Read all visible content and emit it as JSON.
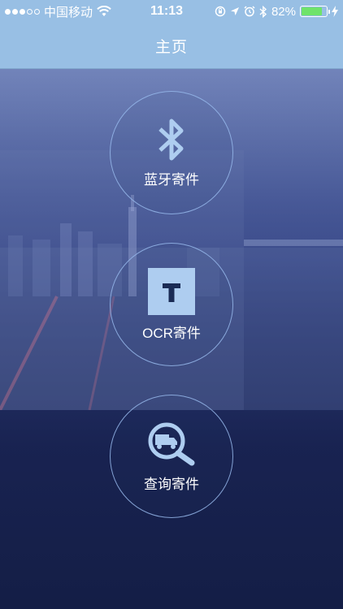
{
  "status_bar": {
    "carrier": "中国移动",
    "time": "11:13",
    "battery_percent": "82%",
    "battery_level": 0.82,
    "signal_bars_filled": 3,
    "signal_bars_total": 5
  },
  "nav": {
    "title": "主页"
  },
  "actions": [
    {
      "label": "蓝牙寄件",
      "icon": "bluetooth-icon"
    },
    {
      "label": "OCR寄件",
      "icon": "ocr-text-icon",
      "icon_text": "T"
    },
    {
      "label": "查询寄件",
      "icon": "search-truck-icon"
    }
  ],
  "colors": {
    "header": "#98bfe4",
    "ring": "#96b9eb",
    "icon_fill": "#aecdf0",
    "battery": "#6fe36a"
  }
}
